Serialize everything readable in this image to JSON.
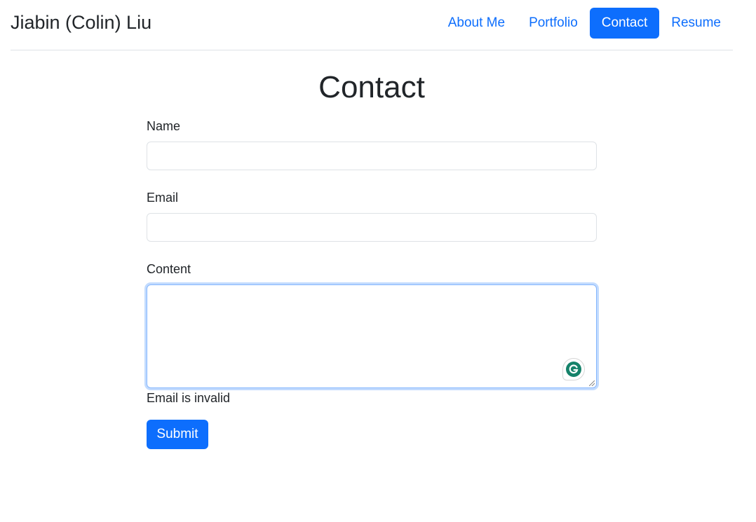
{
  "header": {
    "brand": "Jiabin (Colin) Liu",
    "nav": [
      {
        "label": "About Me",
        "active": false
      },
      {
        "label": "Portfolio",
        "active": false
      },
      {
        "label": "Contact",
        "active": true
      },
      {
        "label": "Resume",
        "active": false
      }
    ]
  },
  "main": {
    "title": "Contact",
    "form": {
      "name_label": "Name",
      "name_value": "",
      "email_label": "Email",
      "email_value": "",
      "content_label": "Content",
      "content_value": "",
      "error_message": "Email is invalid",
      "submit_label": "Submit"
    }
  },
  "colors": {
    "accent": "#0d6efd",
    "text": "#212529",
    "border": "#dee2e6",
    "grammarly": "#15826a"
  },
  "icons": {
    "grammarly": "grammarly-icon",
    "resize": "resize-handle-icon"
  }
}
